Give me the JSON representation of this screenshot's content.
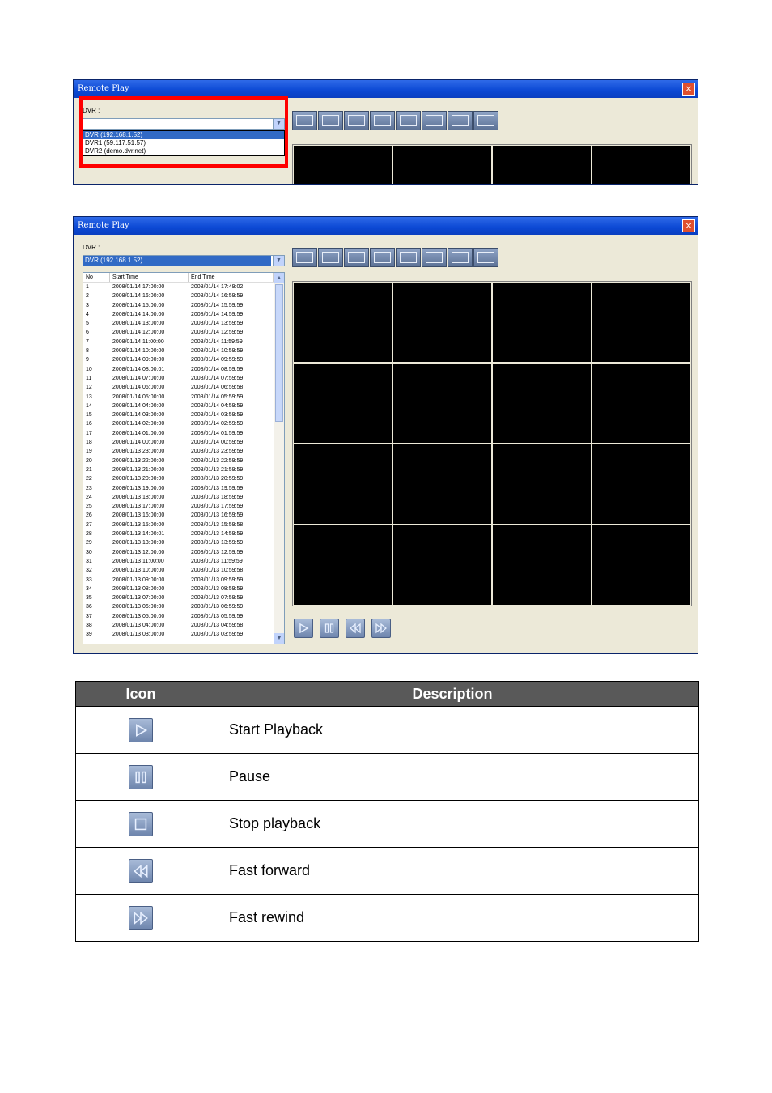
{
  "window1": {
    "title": "Remote Play",
    "close": "×",
    "dvr_label": "DVR :",
    "dvr_value": "",
    "dropdown_options": [
      "DVR (192.168.1.52)",
      "DVR1 (59.117.51.57)",
      "DVR2 (demo.dvr.net)"
    ]
  },
  "window2": {
    "title": "Remote Play",
    "close": "×",
    "dvr_label": "DVR :",
    "dvr_value": "DVR (192.168.1.52)",
    "columns": [
      "No",
      "Start Time",
      "End Time"
    ],
    "rows": [
      [
        "1",
        "2008/01/14 17:00:00",
        "2008/01/14 17:49:02"
      ],
      [
        "2",
        "2008/01/14 16:00:00",
        "2008/01/14 16:59:59"
      ],
      [
        "3",
        "2008/01/14 15:00:00",
        "2008/01/14 15:59:59"
      ],
      [
        "4",
        "2008/01/14 14:00:00",
        "2008/01/14 14:59:59"
      ],
      [
        "5",
        "2008/01/14 13:00:00",
        "2008/01/14 13:59:59"
      ],
      [
        "6",
        "2008/01/14 12:00:00",
        "2008/01/14 12:59:59"
      ],
      [
        "7",
        "2008/01/14 11:00:00",
        "2008/01/14 11:59:59"
      ],
      [
        "8",
        "2008/01/14 10:00:00",
        "2008/01/14 10:59:59"
      ],
      [
        "9",
        "2008/01/14 09:00:00",
        "2008/01/14 09:59:59"
      ],
      [
        "10",
        "2008/01/14 08:00:01",
        "2008/01/14 08:59:59"
      ],
      [
        "11",
        "2008/01/14 07:00:00",
        "2008/01/14 07:59:59"
      ],
      [
        "12",
        "2008/01/14 06:00:00",
        "2008/01/14 06:59:58"
      ],
      [
        "13",
        "2008/01/14 05:00:00",
        "2008/01/14 05:59:59"
      ],
      [
        "14",
        "2008/01/14 04:00:00",
        "2008/01/14 04:59:59"
      ],
      [
        "15",
        "2008/01/14 03:00:00",
        "2008/01/14 03:59:59"
      ],
      [
        "16",
        "2008/01/14 02:00:00",
        "2008/01/14 02:59:59"
      ],
      [
        "17",
        "2008/01/14 01:00:00",
        "2008/01/14 01:59:59"
      ],
      [
        "18",
        "2008/01/14 00:00:00",
        "2008/01/14 00:59:59"
      ],
      [
        "19",
        "2008/01/13 23:00:00",
        "2008/01/13 23:59:59"
      ],
      [
        "20",
        "2008/01/13 22:00:00",
        "2008/01/13 22:59:59"
      ],
      [
        "21",
        "2008/01/13 21:00:00",
        "2008/01/13 21:59:59"
      ],
      [
        "22",
        "2008/01/13 20:00:00",
        "2008/01/13 20:59:59"
      ],
      [
        "23",
        "2008/01/13 19:00:00",
        "2008/01/13 19:59:59"
      ],
      [
        "24",
        "2008/01/13 18:00:00",
        "2008/01/13 18:59:59"
      ],
      [
        "25",
        "2008/01/13 17:00:00",
        "2008/01/13 17:59:59"
      ],
      [
        "26",
        "2008/01/13 16:00:00",
        "2008/01/13 16:59:59"
      ],
      [
        "27",
        "2008/01/13 15:00:00",
        "2008/01/13 15:59:58"
      ],
      [
        "28",
        "2008/01/13 14:00:01",
        "2008/01/13 14:59:59"
      ],
      [
        "29",
        "2008/01/13 13:00:00",
        "2008/01/13 13:59:59"
      ],
      [
        "30",
        "2008/01/13 12:00:00",
        "2008/01/13 12:59:59"
      ],
      [
        "31",
        "2008/01/13 11:00:00",
        "2008/01/13 11:59:59"
      ],
      [
        "32",
        "2008/01/13 10:00:00",
        "2008/01/13 10:59:58"
      ],
      [
        "33",
        "2008/01/13 09:00:00",
        "2008/01/13 09:59:59"
      ],
      [
        "34",
        "2008/01/13 08:00:00",
        "2008/01/13 08:59:59"
      ],
      [
        "35",
        "2008/01/13 07:00:00",
        "2008/01/13 07:59:59"
      ],
      [
        "36",
        "2008/01/13 06:00:00",
        "2008/01/13 06:59:59"
      ],
      [
        "37",
        "2008/01/13 05:00:00",
        "2008/01/13 05:59:59"
      ],
      [
        "38",
        "2008/01/13 04:00:00",
        "2008/01/13 04:59:58"
      ],
      [
        "39",
        "2008/01/13 03:00:00",
        "2008/01/13 03:59:59"
      ]
    ]
  },
  "icon_table": {
    "headers": [
      "Icon",
      "Description"
    ],
    "rows": [
      {
        "icon": "play-icon",
        "description": "Start Playback"
      },
      {
        "icon": "pause-icon",
        "description": "Pause"
      },
      {
        "icon": "stop-icon",
        "description": "Stop playback"
      },
      {
        "icon": "fast-forward-icon",
        "description": "Fast forward"
      },
      {
        "icon": "fast-rewind-icon",
        "description": "Fast rewind"
      }
    ]
  }
}
